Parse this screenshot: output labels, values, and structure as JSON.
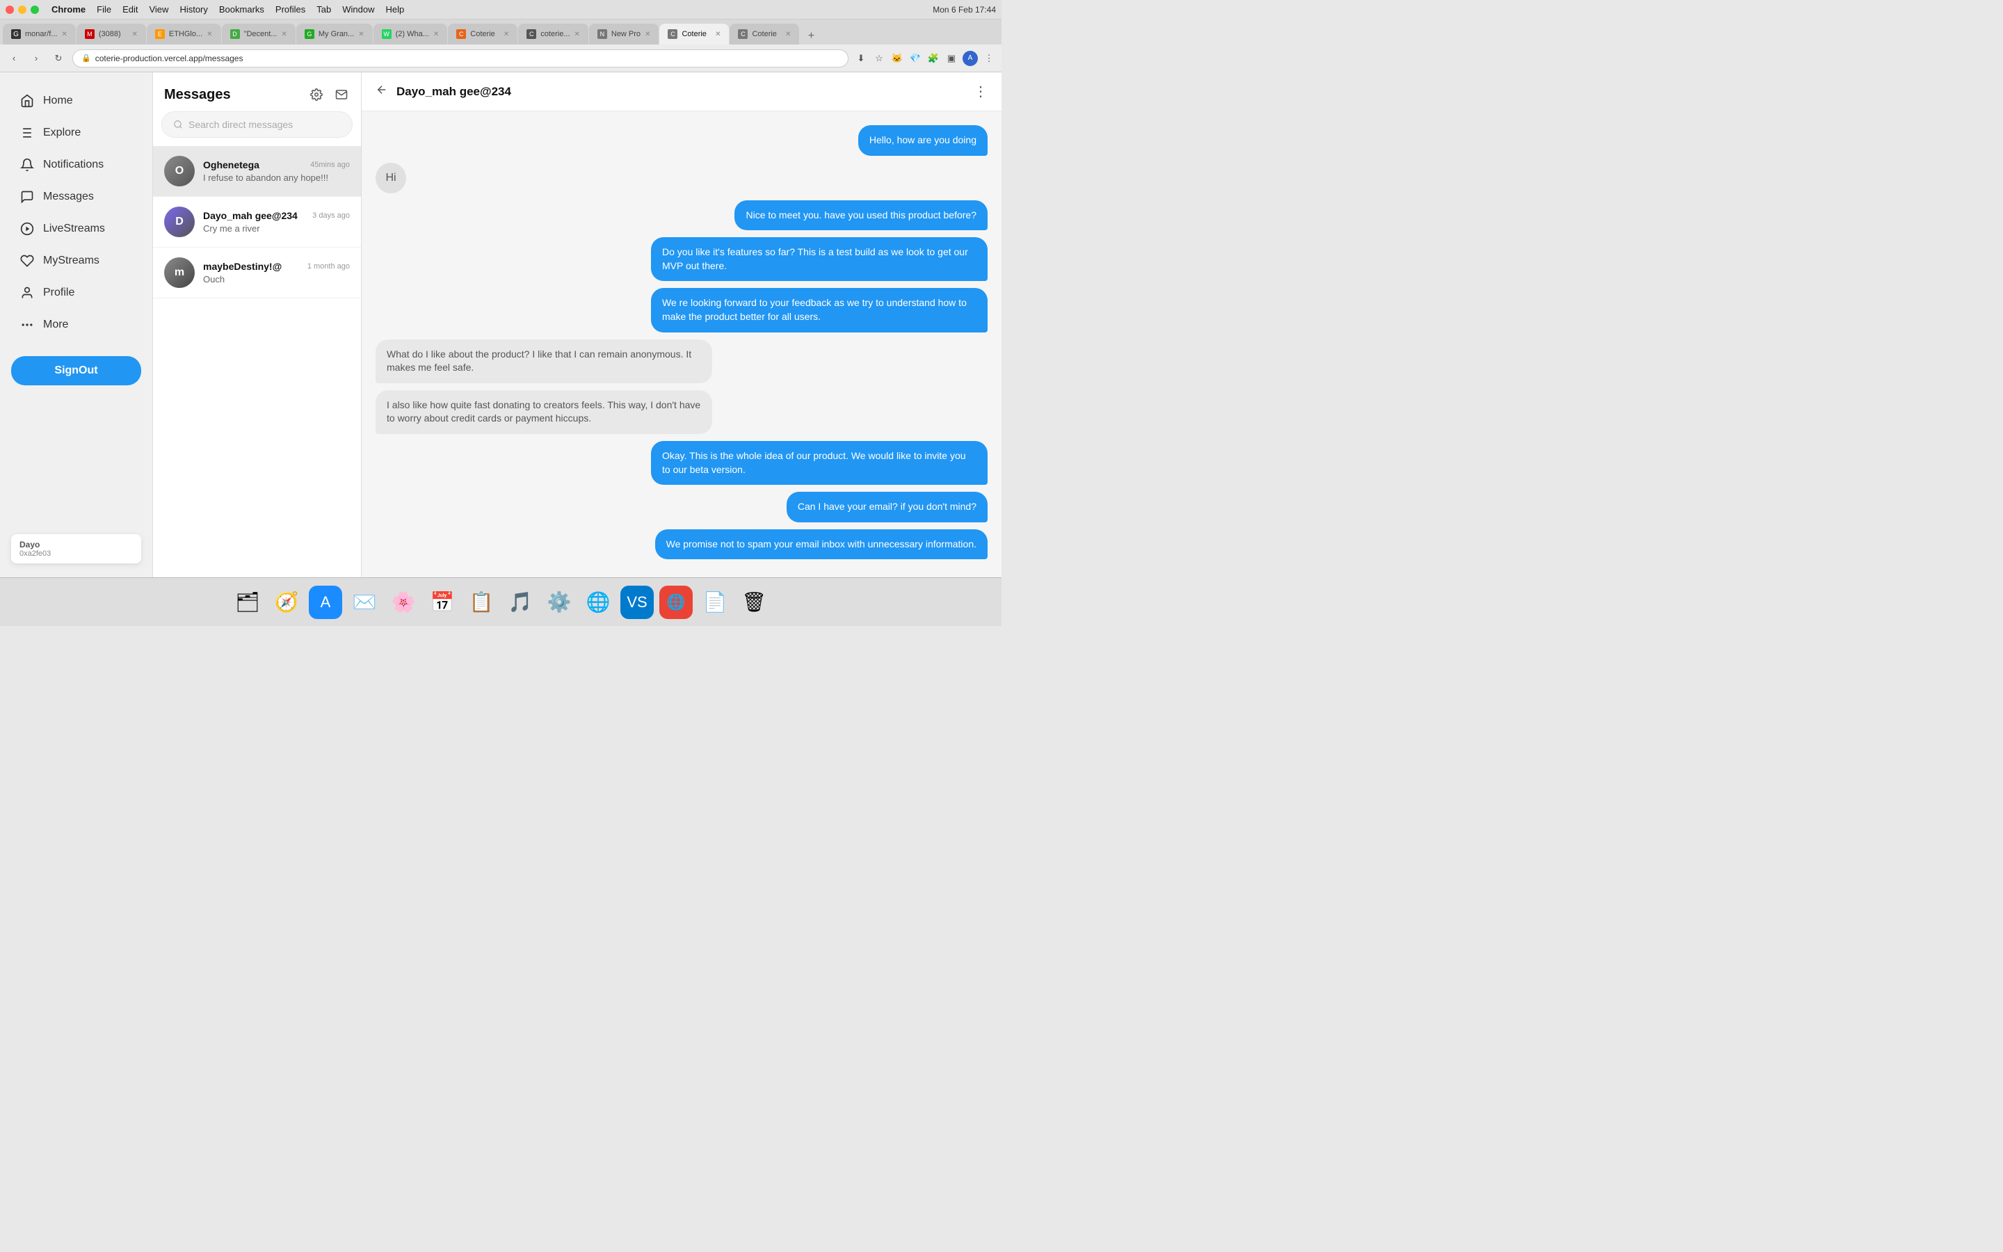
{
  "titlebar": {
    "menus": [
      "Chrome",
      "File",
      "Edit",
      "View",
      "History",
      "Bookmarks",
      "Profiles",
      "Tab",
      "Window",
      "Help"
    ],
    "time": "Mon 6 Feb  17:44"
  },
  "tabs": [
    {
      "id": "github",
      "label": "monar/f...",
      "favicon": "🐙",
      "active": false
    },
    {
      "id": "mail",
      "label": "(3088)",
      "favicon": "✉",
      "active": false
    },
    {
      "id": "eth",
      "label": "ETHGlo...",
      "favicon": "🟡",
      "active": false
    },
    {
      "id": "decent",
      "label": "\"Decent...",
      "favicon": "🟢",
      "active": false
    },
    {
      "id": "mygran",
      "label": "My Gran...",
      "favicon": "🟢",
      "active": false
    },
    {
      "id": "wha",
      "label": "(2) Wha...",
      "favicon": "🟢",
      "active": false
    },
    {
      "id": "coterie1",
      "label": "Coterie",
      "favicon": "🟠",
      "active": false
    },
    {
      "id": "coterie2",
      "label": "coterie...",
      "favicon": "🌐",
      "active": false
    },
    {
      "id": "newpro",
      "label": "New Pro",
      "favicon": "🌐",
      "active": false
    },
    {
      "id": "coterie3",
      "label": "Coterie",
      "favicon": "🌐",
      "active": true
    },
    {
      "id": "coterie4",
      "label": "Coterie",
      "favicon": "🌐",
      "active": false
    }
  ],
  "addressbar": {
    "url": "coterie-production.vercel.app/messages"
  },
  "sidebar": {
    "items": [
      {
        "id": "home",
        "icon": "🏠",
        "label": "Home"
      },
      {
        "id": "explore",
        "icon": "#",
        "label": "Explore"
      },
      {
        "id": "notifications",
        "icon": "🔔",
        "label": "Notifications"
      },
      {
        "id": "messages",
        "icon": "💬",
        "label": "Messages"
      },
      {
        "id": "livestreams",
        "icon": "▶",
        "label": "LiveStreams"
      },
      {
        "id": "mystreams",
        "icon": "🎨",
        "label": "MyStreams"
      },
      {
        "id": "profile",
        "icon": "👤",
        "label": "Profile"
      },
      {
        "id": "more",
        "icon": "•••",
        "label": "More"
      }
    ],
    "signout_label": "SignOut",
    "tooltip": {
      "name": "Dayo",
      "address": "0xa2fe03"
    }
  },
  "messages": {
    "title": "Messages",
    "search_placeholder": "Search direct messages",
    "conversations": [
      {
        "id": "oghenetega",
        "name": "Oghenetega",
        "time": "45mins ago",
        "preview": "I refuse to abandon any hope!!!",
        "active": true
      },
      {
        "id": "dayo_mah",
        "name": "Dayo_mah gee@234",
        "time": "3 days ago",
        "preview": "Cry me a river",
        "active": false
      },
      {
        "id": "maybedestiny",
        "name": "maybeDestiny!@",
        "time": "1 month ago",
        "preview": "Ouch",
        "active": false
      }
    ]
  },
  "chat": {
    "recipient": "Dayo_mah gee@234",
    "messages": [
      {
        "id": 1,
        "type": "sent",
        "text": "Hello, how are you doing"
      },
      {
        "id": 2,
        "type": "hi",
        "text": "Hi"
      },
      {
        "id": 3,
        "type": "sent",
        "text": "Nice to meet you. have you used this product before?"
      },
      {
        "id": 4,
        "type": "sent",
        "text": "Do you like it's features so far? This is a test build as we look to get our MVP out there."
      },
      {
        "id": 5,
        "type": "sent",
        "text": "We re looking forward to your feedback as we try to understand how to make the product better for all users."
      },
      {
        "id": 6,
        "type": "received",
        "text": "What do I like about the product? I like that I can remain anonymous. It makes me feel safe."
      },
      {
        "id": 7,
        "type": "received",
        "text": "I also like how quite fast donating to creators feels. This way, I don't have to worry about credit cards or payment hiccups."
      },
      {
        "id": 8,
        "type": "sent",
        "text": "Okay. This is the whole idea of our product. We would like to invite you to our beta version."
      },
      {
        "id": 9,
        "type": "sent",
        "text": "Can I have your email? if you don't mind?"
      },
      {
        "id": 10,
        "type": "sent",
        "text": "We promise not to spam your email inbox with unnecessary information."
      }
    ]
  },
  "dock": {
    "items": [
      {
        "id": "finder",
        "icon": "🗂",
        "label": "Finder"
      },
      {
        "id": "safari",
        "icon": "🧭",
        "label": "Safari"
      },
      {
        "id": "appstore",
        "icon": "🅐",
        "label": "App Store"
      },
      {
        "id": "mail",
        "icon": "✉",
        "label": "Mail"
      },
      {
        "id": "photos",
        "icon": "🖼",
        "label": "Photos"
      },
      {
        "id": "calendar",
        "icon": "📅",
        "label": "Calendar"
      },
      {
        "id": "freeform",
        "icon": "📋",
        "label": "Freeform"
      },
      {
        "id": "music",
        "icon": "🎵",
        "label": "Music"
      },
      {
        "id": "settings",
        "icon": "⚙",
        "label": "System Settings"
      },
      {
        "id": "chrome",
        "icon": "🌐",
        "label": "Chrome"
      },
      {
        "id": "vscode",
        "icon": "📝",
        "label": "VS Code"
      },
      {
        "id": "chrome2",
        "icon": "🌐",
        "label": "Chrome 2"
      },
      {
        "id": "files",
        "icon": "📄",
        "label": "Files"
      },
      {
        "id": "trash",
        "icon": "🗑",
        "label": "Trash"
      }
    ]
  }
}
